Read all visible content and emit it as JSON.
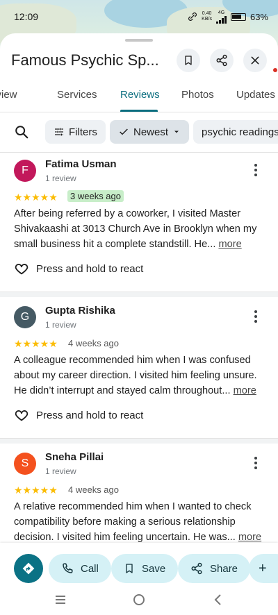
{
  "status": {
    "time": "12:09",
    "net_speed_top": "0.40",
    "net_speed_bottom": "KB/s",
    "network_type": "4G",
    "battery": "63%"
  },
  "header": {
    "title": "Famous Psychic Sp..."
  },
  "tabs": [
    {
      "label": "Overview"
    },
    {
      "label": "Services"
    },
    {
      "label": "Reviews"
    },
    {
      "label": "Photos"
    },
    {
      "label": "Updates"
    }
  ],
  "filters": {
    "filters_label": "Filters",
    "sort_label": "Newest",
    "topic_label": "psychic readings"
  },
  "reviews": [
    {
      "initial": "F",
      "avatar_color": "#c2185b",
      "name": "Fatima Usman",
      "count": "1 review",
      "stars": "★★★★★",
      "time_ago": "3 weeks ago",
      "text": "After being referred by a coworker, I visited Master Shivakaashi at 3013 Church Ave in Brooklyn when my small business hit a complete standstill. He...",
      "more": "more",
      "react": "Press and hold to react"
    },
    {
      "initial": "G",
      "avatar_color": "#455a64",
      "name": "Gupta Rishika",
      "count": "1 review",
      "stars": "★★★★★",
      "time_ago": "4 weeks ago",
      "text": "A colleague recommended him when I was confused about my career direction. I visited him feeling unsure. He didn’t interrupt and stayed calm throughout...",
      "more": "more",
      "react": "Press and hold to react"
    },
    {
      "initial": "S",
      "avatar_color": "#f4511e",
      "name": "Sneha Pillai",
      "count": "1 review",
      "stars": "★★★★★",
      "time_ago": "4 weeks ago",
      "text": "A relative recommended him when I wanted to check compatibility before making a serious relationship decision. I visited him feeling uncertain. He was...",
      "more": "more"
    }
  ],
  "actions": {
    "call": "Call",
    "save": "Save",
    "share": "Share",
    "more_partial": "+"
  },
  "colors": {
    "accent": "#0b6e7f",
    "action_bg": "#d5f1f6",
    "star": "#fbbc04"
  }
}
